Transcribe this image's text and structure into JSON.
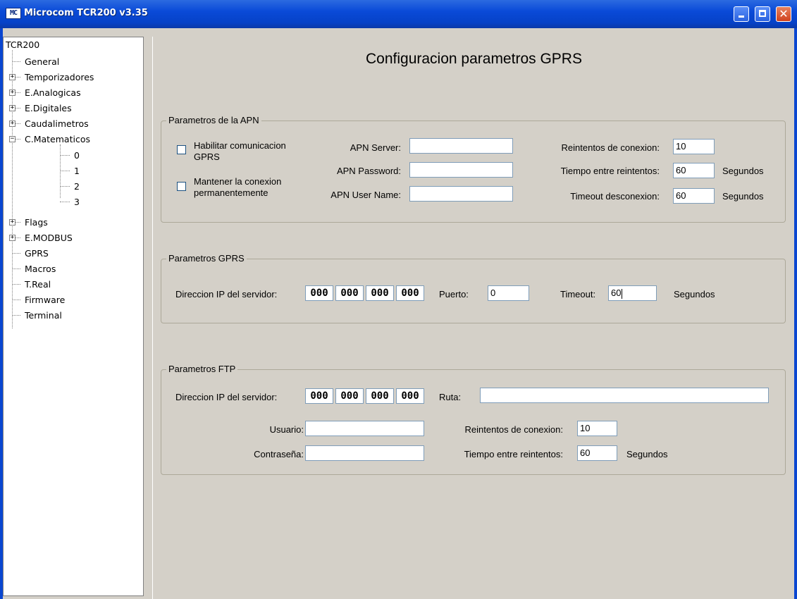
{
  "window": {
    "title": "Microcom TCR200 v3.35",
    "icon_name": "microcom-app-icon",
    "icon_text": "MC"
  },
  "tree": {
    "root": "TCR200",
    "items": [
      {
        "label": "General",
        "expandable": false
      },
      {
        "label": "Temporizadores",
        "expandable": true,
        "expanded": false
      },
      {
        "label": "E.Analogicas",
        "expandable": true,
        "expanded": false
      },
      {
        "label": "E.Digitales",
        "expandable": true,
        "expanded": false
      },
      {
        "label": "Caudalimetros",
        "expandable": true,
        "expanded": false
      },
      {
        "label": "C.Matematicos",
        "expandable": true,
        "expanded": true,
        "children": [
          "0",
          "1",
          "2",
          "3"
        ]
      },
      {
        "label": "Flags",
        "expandable": true,
        "expanded": false
      },
      {
        "label": "E.MODBUS",
        "expandable": true,
        "expanded": false
      },
      {
        "label": "GPRS",
        "expandable": false
      },
      {
        "label": "Macros",
        "expandable": false
      },
      {
        "label": "T.Real",
        "expandable": false
      },
      {
        "label": "Firmware",
        "expandable": false
      },
      {
        "label": "Terminal",
        "expandable": false
      }
    ]
  },
  "main": {
    "title": "Configuracion parametros GPRS",
    "apn": {
      "legend": "Parametros de la APN",
      "enable_gprs_label": "Habilitar comunicacion GPRS",
      "enable_gprs_checked": false,
      "keep_conn_label": "Mantener la conexion permanentemente",
      "keep_conn_checked": false,
      "server_label": "APN Server:",
      "server_value": "",
      "password_label": "APN Password:",
      "password_value": "",
      "user_label": "APN User Name:",
      "user_value": "",
      "retries_label": "Reintentos de conexion:",
      "retries_value": "10",
      "retry_time_label": "Tiempo entre reintentos:",
      "retry_time_value": "60",
      "retry_time_unit": "Segundos",
      "timeout_label": "Timeout desconexion:",
      "timeout_value": "60",
      "timeout_unit": "Segundos"
    },
    "gprs": {
      "legend": "Parametros GPRS",
      "ip_label": "Direccion IP del servidor:",
      "ip": [
        "000",
        "000",
        "000",
        "000"
      ],
      "port_label": "Puerto:",
      "port_value": "0",
      "timeout_label": "Timeout:",
      "timeout_value": "60",
      "timeout_unit": "Segundos"
    },
    "ftp": {
      "legend": "Parametros FTP",
      "ip_label": "Direccion IP del servidor:",
      "ip": [
        "000",
        "000",
        "000",
        "000"
      ],
      "path_label": "Ruta:",
      "path_value": "",
      "user_label": "Usuario:",
      "user_value": "",
      "password_label": "Contraseña:",
      "password_value": "",
      "retries_label": "Reintentos de conexion:",
      "retries_value": "10",
      "retry_time_label": "Tiempo entre reintentos:",
      "retry_time_value": "60",
      "retry_time_unit": "Segundos"
    }
  },
  "colors": {
    "titlebar": "#0a4ad8",
    "panel": "#d4d0c8",
    "close_button": "#d0421e",
    "field_border": "#7f9db9"
  }
}
